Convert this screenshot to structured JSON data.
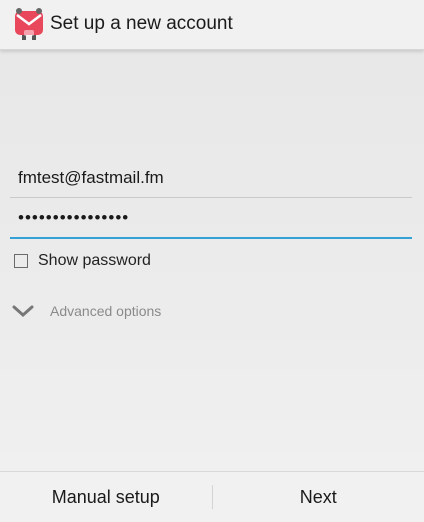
{
  "appbar": {
    "title": "Set up a new account",
    "icon": "k9-mail-app-icon",
    "accent": "#e8475c"
  },
  "form": {
    "email_value": "fmtest@fastmail.fm",
    "password_value": "••••••••••••••••",
    "show_password_label": "Show password",
    "show_password_checked": false,
    "advanced_label": "Advanced options",
    "focus_color": "#33a0d6"
  },
  "footer": {
    "manual_label": "Manual setup",
    "next_label": "Next"
  }
}
